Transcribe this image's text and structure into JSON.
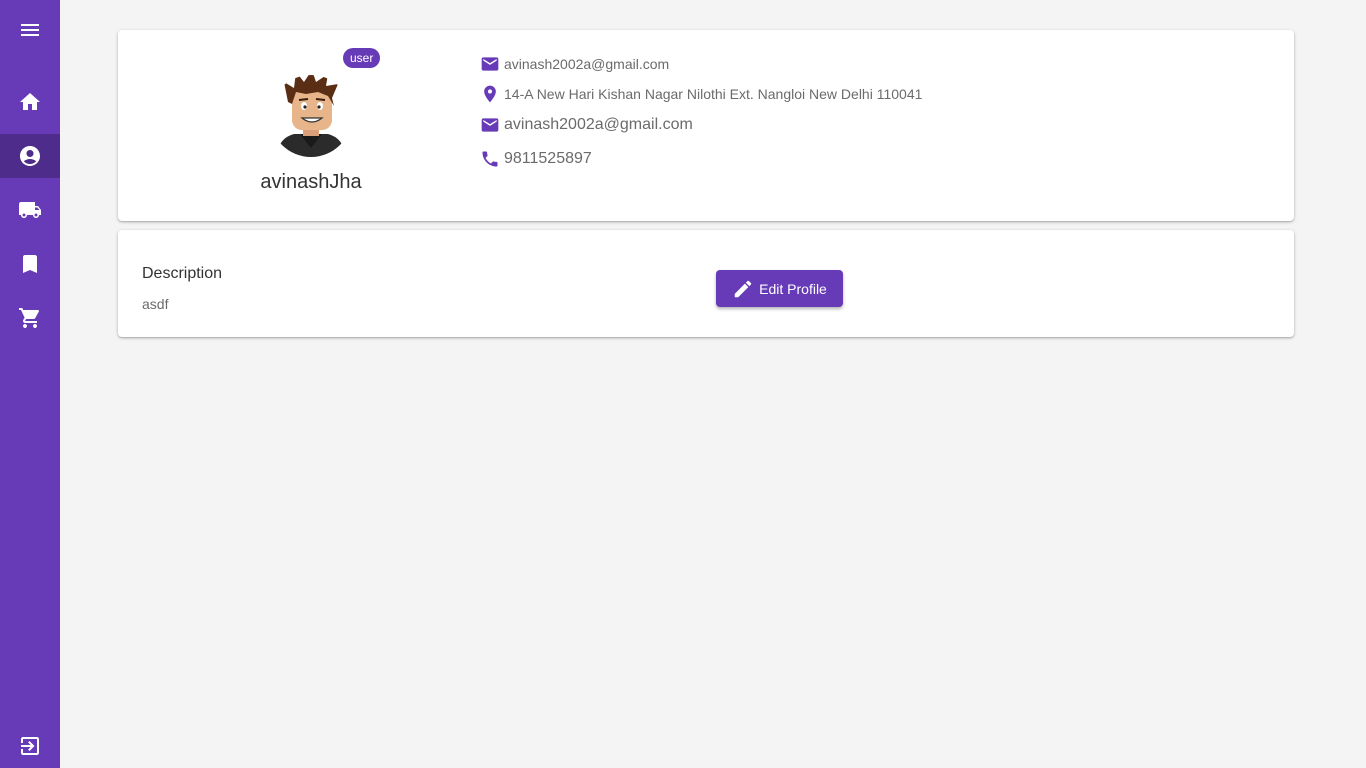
{
  "sidebar": {
    "items": [
      {
        "icon": "menu-icon",
        "active": false
      },
      {
        "icon": "home-icon",
        "active": false
      },
      {
        "icon": "account-circle-icon",
        "active": true
      },
      {
        "icon": "truck-icon",
        "active": false
      },
      {
        "icon": "bookmark-icon",
        "active": false
      },
      {
        "icon": "cart-icon",
        "active": false
      },
      {
        "icon": "logout-icon",
        "active": false
      }
    ],
    "color": "#673ab7",
    "active_color": "#4d2c8b"
  },
  "profile": {
    "role_badge": "user",
    "username": "avinashJha",
    "email": "avinash2002a@gmail.com",
    "address": "14-A New Hari Kishan Nagar Nilothi Ext. Nangloi New Delhi 110041",
    "contact_email": "avinash2002a@gmail.com",
    "phone": "9811525897"
  },
  "description": {
    "title": "Description",
    "text": "asdf"
  },
  "actions": {
    "edit_label": "Edit Profile"
  },
  "colors": {
    "accent": "#673ab7",
    "background": "#f4f4f4"
  }
}
